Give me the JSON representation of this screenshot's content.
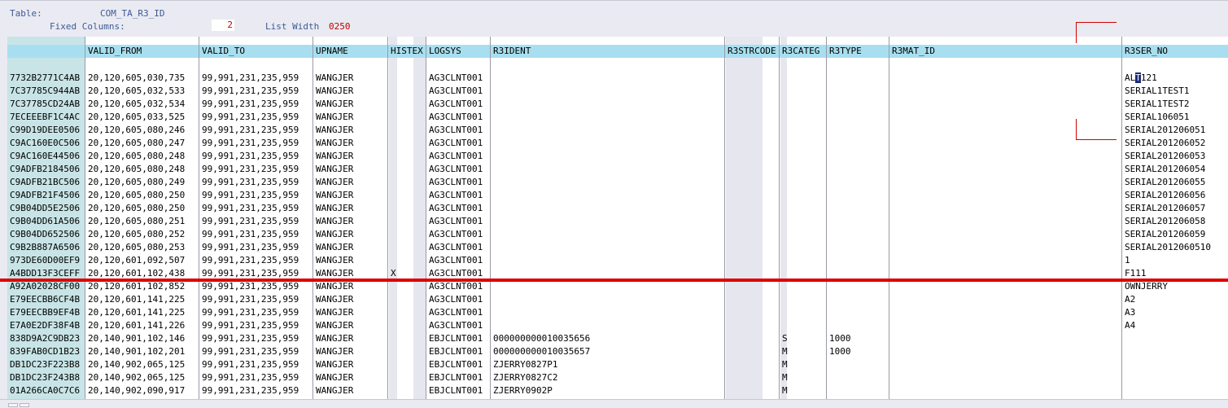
{
  "header": {
    "table_label": "Table:",
    "table_name": "COM_TA_R3_ID",
    "fixed_columns_label": "Fixed Columns:",
    "fixed_columns_value": "2",
    "list_width_label": "List Width",
    "list_width_value": "0250"
  },
  "columns": [
    "",
    "VALID_FROM",
    "VALID_TO",
    "UPNAME",
    "HISTEX",
    "LOGSYS",
    "R3IDENT",
    "R3STRCODE",
    "R3CATEG",
    "R3TYPE",
    "R3MAT_ID",
    "R3SER_NO"
  ],
  "rows": [
    [
      "7732B2771C4AB",
      "20,120,605,030,735",
      "99,991,231,235,959",
      "WANGJER",
      "",
      "AG3CLNT001",
      "",
      "",
      "",
      "",
      "",
      "ALT121"
    ],
    [
      "7C37785C944AB",
      "20,120,605,032,533",
      "99,991,231,235,959",
      "WANGJER",
      "",
      "AG3CLNT001",
      "",
      "",
      "",
      "",
      "",
      "SERIAL1TEST1"
    ],
    [
      "7C37785CD24AB",
      "20,120,605,032,534",
      "99,991,231,235,959",
      "WANGJER",
      "",
      "AG3CLNT001",
      "",
      "",
      "",
      "",
      "",
      "SERIAL1TEST2"
    ],
    [
      "7ECEEEBF1C4AC",
      "20,120,605,033,525",
      "99,991,231,235,959",
      "WANGJER",
      "",
      "AG3CLNT001",
      "",
      "",
      "",
      "",
      "",
      "SERIAL106051"
    ],
    [
      "C99D19DEE0506",
      "20,120,605,080,246",
      "99,991,231,235,959",
      "WANGJER",
      "",
      "AG3CLNT001",
      "",
      "",
      "",
      "",
      "",
      "SERIAL201206051"
    ],
    [
      "C9AC160E0C506",
      "20,120,605,080,247",
      "99,991,231,235,959",
      "WANGJER",
      "",
      "AG3CLNT001",
      "",
      "",
      "",
      "",
      "",
      "SERIAL201206052"
    ],
    [
      "C9AC160E44506",
      "20,120,605,080,248",
      "99,991,231,235,959",
      "WANGJER",
      "",
      "AG3CLNT001",
      "",
      "",
      "",
      "",
      "",
      "SERIAL201206053"
    ],
    [
      "C9ADFB2184506",
      "20,120,605,080,248",
      "99,991,231,235,959",
      "WANGJER",
      "",
      "AG3CLNT001",
      "",
      "",
      "",
      "",
      "",
      "SERIAL201206054"
    ],
    [
      "C9ADFB21BC506",
      "20,120,605,080,249",
      "99,991,231,235,959",
      "WANGJER",
      "",
      "AG3CLNT001",
      "",
      "",
      "",
      "",
      "",
      "SERIAL201206055"
    ],
    [
      "C9ADFB21F4506",
      "20,120,605,080,250",
      "99,991,231,235,959",
      "WANGJER",
      "",
      "AG3CLNT001",
      "",
      "",
      "",
      "",
      "",
      "SERIAL201206056"
    ],
    [
      "C9B04DD5E2506",
      "20,120,605,080,250",
      "99,991,231,235,959",
      "WANGJER",
      "",
      "AG3CLNT001",
      "",
      "",
      "",
      "",
      "",
      "SERIAL201206057"
    ],
    [
      "C9B04DD61A506",
      "20,120,605,080,251",
      "99,991,231,235,959",
      "WANGJER",
      "",
      "AG3CLNT001",
      "",
      "",
      "",
      "",
      "",
      "SERIAL201206058"
    ],
    [
      "C9B04DD652506",
      "20,120,605,080,252",
      "99,991,231,235,959",
      "WANGJER",
      "",
      "AG3CLNT001",
      "",
      "",
      "",
      "",
      "",
      "SERIAL201206059"
    ],
    [
      "C9B2B887A6506",
      "20,120,605,080,253",
      "99,991,231,235,959",
      "WANGJER",
      "",
      "AG3CLNT001",
      "",
      "",
      "",
      "",
      "",
      "SERIAL2012060510"
    ],
    [
      "973DE60D00EF9",
      "20,120,601,092,507",
      "99,991,231,235,959",
      "WANGJER",
      "",
      "AG3CLNT001",
      "",
      "",
      "",
      "",
      "",
      "1"
    ],
    [
      "A4BDD13F3CEFF",
      "20,120,601,102,438",
      "99,991,231,235,959",
      "WANGJER",
      "X",
      "AG3CLNT001",
      "",
      "",
      "",
      "",
      "",
      "F111"
    ],
    [
      "A92A02028CF00",
      "20,120,601,102,852",
      "99,991,231,235,959",
      "WANGJER",
      "",
      "AG3CLNT001",
      "",
      "",
      "",
      "",
      "",
      "OWNJERRY"
    ],
    [
      "E79EECBB6CF4B",
      "20,120,601,141,225",
      "99,991,231,235,959",
      "WANGJER",
      "",
      "AG3CLNT001",
      "",
      "",
      "",
      "",
      "",
      "A2"
    ],
    [
      "E79EECBB9EF4B",
      "20,120,601,141,225",
      "99,991,231,235,959",
      "WANGJER",
      "",
      "AG3CLNT001",
      "",
      "",
      "",
      "",
      "",
      "A3"
    ],
    [
      "E7A0E2DF38F4B",
      "20,120,601,141,226",
      "99,991,231,235,959",
      "WANGJER",
      "",
      "AG3CLNT001",
      "",
      "",
      "",
      "",
      "",
      "A4"
    ],
    [
      "838D9A2C9DB23",
      "20,140,901,102,146",
      "99,991,231,235,959",
      "WANGJER",
      "",
      "EBJCLNT001",
      "000000000010035656",
      "",
      "S",
      "1000",
      "",
      ""
    ],
    [
      "839FAB0CD1B23",
      "20,140,901,102,201",
      "99,991,231,235,959",
      "WANGJER",
      "",
      "EBJCLNT001",
      "000000000010035657",
      "",
      "M",
      "1000",
      "",
      ""
    ],
    [
      "DB1DC23F223B8",
      "20,140,902,065,125",
      "99,991,231,235,959",
      "WANGJER",
      "",
      "EBJCLNT001",
      "ZJERRY0827P1",
      "",
      "M",
      "",
      "",
      ""
    ],
    [
      "DB1DC23F243B8",
      "20,140,902,065,125",
      "99,991,231,235,959",
      "WANGJER",
      "",
      "EBJCLNT001",
      "ZJERRY0827C2",
      "",
      "M",
      "",
      "",
      ""
    ],
    [
      "01A266CA0C7C6",
      "20,140,902,090,917",
      "99,991,231,235,959",
      "WANGJER",
      "",
      "EBJCLNT001",
      "ZJERRY0902P",
      "",
      "M",
      "",
      "",
      ""
    ]
  ],
  "colors": {
    "header_band": "#a8dff0",
    "key_column": "#c8e4e6",
    "gray_column": "#e6e6ee",
    "fixed_value_red": "#c00000",
    "annotation_red": "#d00000"
  }
}
